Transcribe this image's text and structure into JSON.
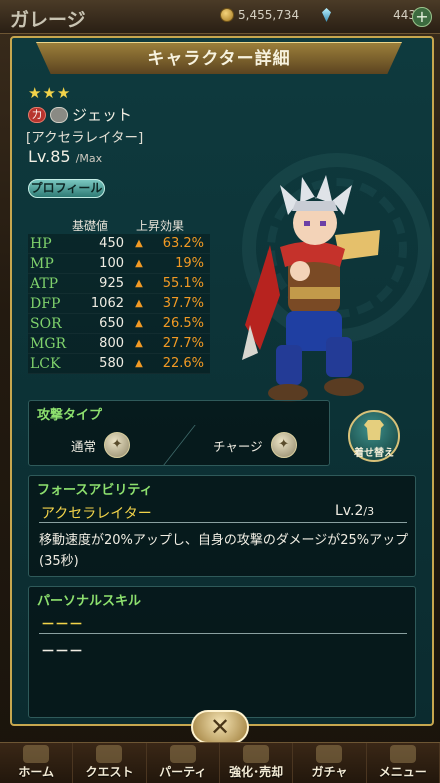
{
  "topbar": {
    "title": "ガレージ",
    "coins": "5,455,734",
    "gems": "443",
    "plus": "+"
  },
  "dialog": {
    "title": "キャラクター詳細"
  },
  "character": {
    "stars": "★★★",
    "element_tag": "力",
    "name": "ジェット",
    "subtitle": "[アクセラレイター]",
    "level_prefix": "Lv.",
    "level": "85",
    "level_max": "/Max",
    "profile_button": "プロフィール"
  },
  "stats": {
    "header_base": "基礎値",
    "header_bonus": "上昇効果",
    "rows": [
      {
        "key": "HP",
        "value": "450",
        "bonus": "63.2%"
      },
      {
        "key": "MP",
        "value": "100",
        "bonus": "19%"
      },
      {
        "key": "ATP",
        "value": "925",
        "bonus": "55.1%"
      },
      {
        "key": "DFP",
        "value": "1062",
        "bonus": "37.7%"
      },
      {
        "key": "SOR",
        "value": "650",
        "bonus": "26.5%"
      },
      {
        "key": "MGR",
        "value": "800",
        "bonus": "27.7%"
      },
      {
        "key": "LCK",
        "value": "580",
        "bonus": "22.6%"
      }
    ],
    "arrow": "▲"
  },
  "attack": {
    "label": "攻撃タイプ",
    "normal": "通常",
    "charge": "チャージ"
  },
  "dress_button": "着せ替え",
  "force": {
    "label": "フォースアビリティ",
    "ability_name": "アクセラレイター",
    "level_prefix": "Lv.",
    "level": "2",
    "level_max": "/3",
    "description": "移動速度が20%アップし、自身の攻撃のダメージが25%アップ(35秒)"
  },
  "personal": {
    "label": "パーソナルスキル",
    "name": "－－－",
    "description": "－－－"
  },
  "close_button": "✕",
  "nav": [
    "ホーム",
    "クエスト",
    "パーティ",
    "強化･売却",
    "ガチャ",
    "メニュー"
  ],
  "colors": {
    "accent_gold": "#c7a74f",
    "stat_green": "#7fd26c",
    "bonus_orange": "#f29a24",
    "panel_teal": "#0e3a3e"
  }
}
